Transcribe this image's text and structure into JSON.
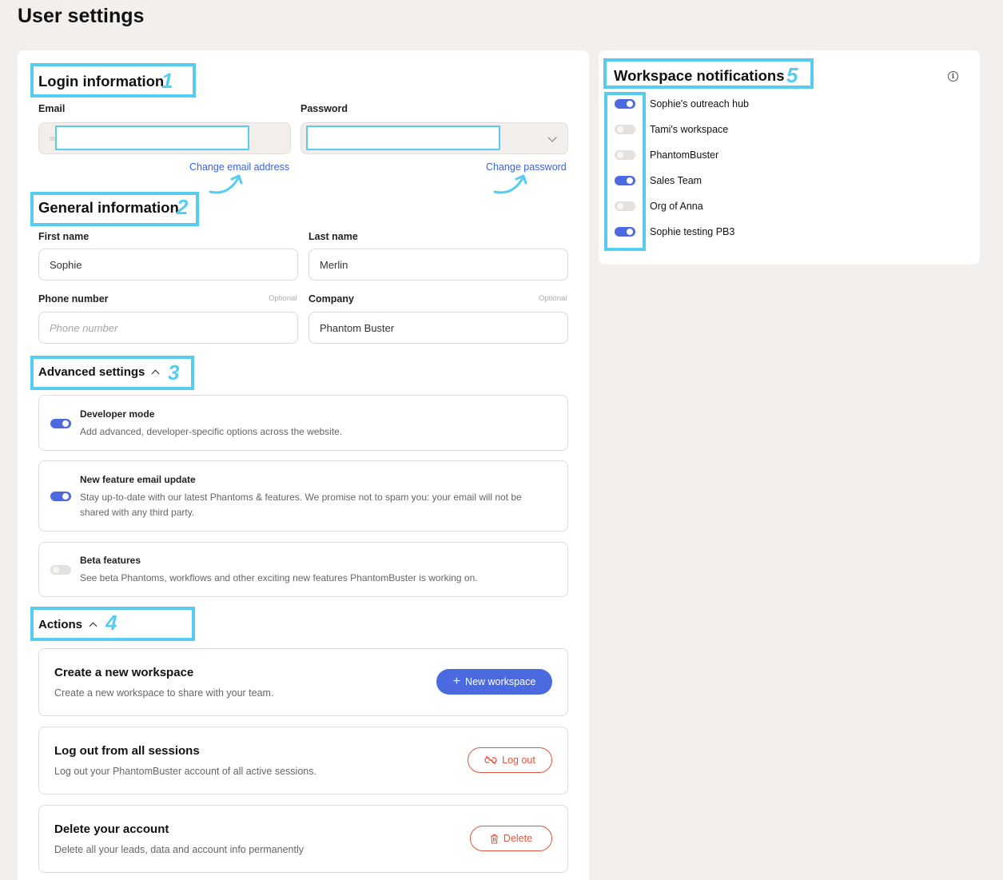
{
  "page": {
    "title": "User settings"
  },
  "login": {
    "heading": "Login information",
    "annotation": "1",
    "email_label": "Email",
    "email_value_fragment": "so",
    "password_label": "Password",
    "change_email": "Change email address",
    "change_password": "Change password"
  },
  "general": {
    "heading": "General information",
    "annotation": "2",
    "first_name_label": "First name",
    "first_name_value": "Sophie",
    "last_name_label": "Last name",
    "last_name_value": "Merlin",
    "phone_label": "Phone number",
    "phone_optional": "Optional",
    "phone_placeholder": "Phone number",
    "company_label": "Company",
    "company_optional": "Optional",
    "company_value": "Phantom Buster"
  },
  "advanced": {
    "heading": "Advanced settings",
    "annotation": "3",
    "items": [
      {
        "title": "Developer mode",
        "desc": "Add advanced, developer-specific options across the website.",
        "on": true
      },
      {
        "title": "New feature email update",
        "desc": "Stay up-to-date with our latest Phantoms & features. We promise not to spam you: your email will not be shared with any third party.",
        "on": true
      },
      {
        "title": "Beta features",
        "desc": "See beta Phantoms, workflows and other exciting new features PhantomBuster is working on.",
        "on": false
      }
    ]
  },
  "actions": {
    "heading": "Actions",
    "annotation": "4",
    "create": {
      "title": "Create a new workspace",
      "desc": "Create a new workspace to share with your team.",
      "button": "New workspace"
    },
    "logout": {
      "title": "Log out from all sessions",
      "desc": "Log out your PhantomBuster account of all active sessions.",
      "button": "Log out"
    },
    "delete": {
      "title": "Delete your account",
      "desc": "Delete all your leads, data and account info permanently",
      "button": "Delete"
    }
  },
  "notifications": {
    "heading": "Workspace notifications",
    "annotation": "5",
    "items": [
      {
        "name": "Sophie's outreach hub",
        "on": true
      },
      {
        "name": "Tami's workspace",
        "on": false
      },
      {
        "name": "PhantomBuster",
        "on": false
      },
      {
        "name": "Sales Team",
        "on": true
      },
      {
        "name": "Org of Anna",
        "on": false
      },
      {
        "name": "Sophie testing PB3",
        "on": true
      }
    ]
  },
  "colors": {
    "accent": "#4c6ae0",
    "annotation": "#56cdef",
    "danger": "#e0553f",
    "link": "#3b63d9"
  },
  "icons": {
    "chevron": "chevron-down-icon",
    "info": "info-icon",
    "plus": "plus-icon",
    "logout": "unlink-icon",
    "trash": "trash-icon"
  }
}
